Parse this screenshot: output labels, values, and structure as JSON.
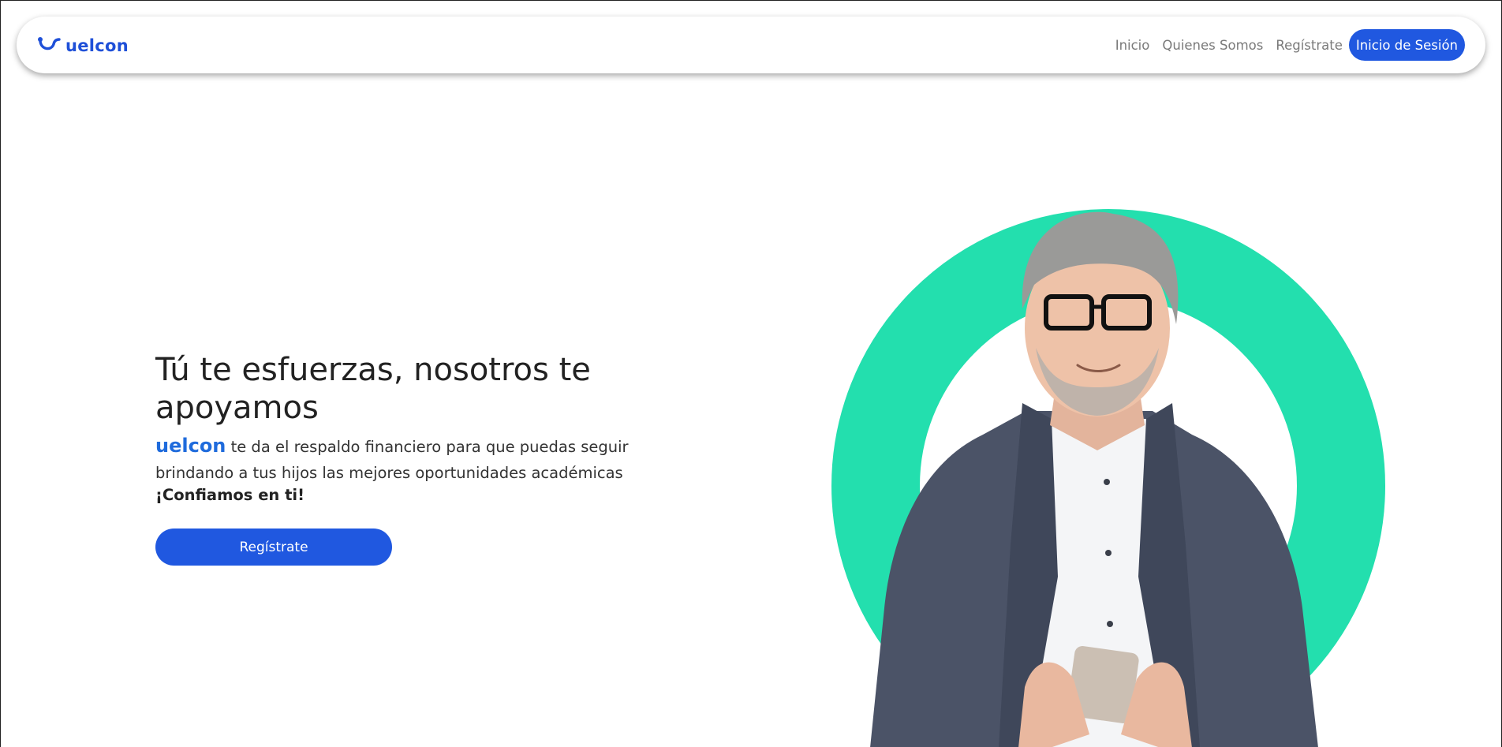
{
  "brand": {
    "name": "uelcon",
    "color": "#1f50d8"
  },
  "nav": {
    "links": [
      "Inicio",
      "Quienes Somos",
      "Regístrate"
    ],
    "cta": "Inicio de Sesión"
  },
  "hero": {
    "title": "Tú te esfuerzas, nosotros te apoyamos",
    "brand_inline": "uelcon",
    "description": "te da el respaldo financiero para que puedas seguir brindando a tus hijos las mejores oportunidades académicas",
    "trust": "¡Confiamos en ti!",
    "cta": "Regístrate"
  },
  "colors": {
    "accent": "#2058e0",
    "ring": "#23dfae",
    "text": "#222222"
  },
  "icons": {
    "logo": "stethoscope-smile-icon"
  },
  "image": {
    "subject": "man-with-phone-photo"
  }
}
